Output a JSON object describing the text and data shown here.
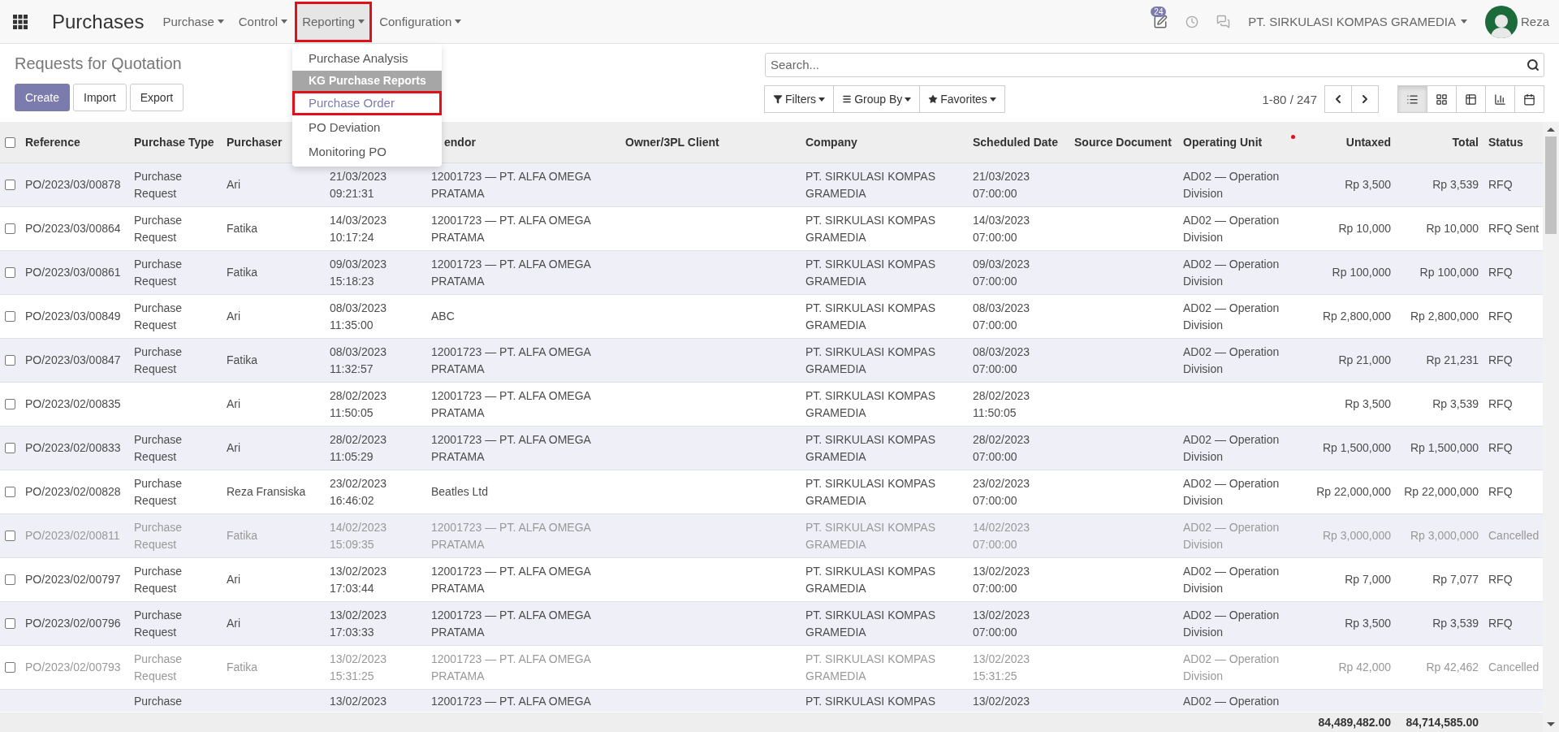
{
  "navbar": {
    "app_title": "Purchases",
    "menus": [
      {
        "label": "Purchase",
        "open": false,
        "highlighted": false
      },
      {
        "label": "Control",
        "open": false,
        "highlighted": false
      },
      {
        "label": "Reporting",
        "open": true,
        "highlighted": true
      },
      {
        "label": "Configuration",
        "open": false,
        "highlighted": false
      }
    ],
    "activity_count": "24",
    "company": "PT. SIRKULASI KOMPAS GRAMEDIA",
    "user": "Reza"
  },
  "reporting_menu": [
    {
      "kind": "item",
      "label": "Purchase Analysis",
      "highlighted": false
    },
    {
      "kind": "header",
      "label": "KG Purchase Reports",
      "highlighted": false
    },
    {
      "kind": "item",
      "label": "Purchase Order",
      "highlighted": true
    },
    {
      "kind": "item",
      "label": "PO Deviation",
      "highlighted": false
    },
    {
      "kind": "item",
      "label": "Monitoring PO",
      "highlighted": false
    }
  ],
  "control_panel": {
    "breadcrumb": "Requests for Quotation",
    "buttons": [
      {
        "label": "Create",
        "primary": true
      },
      {
        "label": "Import",
        "primary": false
      },
      {
        "label": "Export",
        "primary": false
      }
    ],
    "search": {
      "placeholder": "Search..."
    },
    "filters": [
      "Filters",
      "Group By",
      "Favorites"
    ],
    "pager": "1-80 / 247",
    "views": [
      {
        "kind": "list",
        "selected": true
      },
      {
        "kind": "kanban",
        "selected": false
      },
      {
        "kind": "pivot",
        "selected": false
      },
      {
        "kind": "graph",
        "selected": false
      },
      {
        "kind": "calendar",
        "selected": false
      }
    ]
  },
  "table": {
    "select_all_checked": false,
    "columns": [
      {
        "label": "Reference"
      },
      {
        "label": "Purchase Type"
      },
      {
        "label": "Purchaser"
      },
      {},
      {
        "label": "endor"
      },
      {
        "label": "Owner/3PL Client"
      },
      {
        "label": "Company"
      },
      {
        "label": "Scheduled Date"
      },
      {
        "label": "Source Document"
      },
      {
        "label": "Operating Unit"
      },
      {
        "label": "Untaxed"
      },
      {
        "label": "Total"
      },
      {
        "label": "Status"
      }
    ],
    "rows": [
      {
        "kind": "full",
        "checked": false,
        "muted": false,
        "cells": [
          "PO/2023/03/00878",
          "Purchase Request",
          "Ari",
          "21/03/2023 09:21:31",
          "12001723 — PT. ALFA OMEGA PRATAMA",
          "",
          "PT. SIRKULASI KOMPAS GRAMEDIA",
          "21/03/2023 07:00:00",
          "",
          "AD02 — Operation Division",
          "Rp 3,500",
          "Rp 3,539",
          "RFQ"
        ]
      },
      {
        "kind": "full",
        "checked": false,
        "muted": false,
        "cells": [
          "PO/2023/03/00864",
          "Purchase Request",
          "Fatika",
          "14/03/2023 10:17:24",
          "12001723 — PT. ALFA OMEGA PRATAMA",
          "",
          "PT. SIRKULASI KOMPAS GRAMEDIA",
          "14/03/2023 07:00:00",
          "",
          "AD02 — Operation Division",
          "Rp 10,000",
          "Rp 10,000",
          "RFQ Sent"
        ]
      },
      {
        "kind": "full",
        "checked": false,
        "muted": false,
        "cells": [
          "PO/2023/03/00861",
          "Purchase Request",
          "Fatika",
          "09/03/2023 15:18:23",
          "12001723 — PT. ALFA OMEGA PRATAMA",
          "",
          "PT. SIRKULASI KOMPAS GRAMEDIA",
          "09/03/2023 07:00:00",
          "",
          "AD02 — Operation Division",
          "Rp 100,000",
          "Rp 100,000",
          "RFQ"
        ]
      },
      {
        "kind": "full",
        "checked": false,
        "muted": false,
        "cells": [
          "PO/2023/03/00849",
          "Purchase Request",
          "Ari",
          "08/03/2023 11:35:00",
          "ABC",
          "",
          "PT. SIRKULASI KOMPAS GRAMEDIA",
          "08/03/2023 07:00:00",
          "",
          "AD02 — Operation Division",
          "Rp 2,800,000",
          "Rp 2,800,000",
          "RFQ"
        ]
      },
      {
        "kind": "full",
        "checked": false,
        "muted": false,
        "cells": [
          "PO/2023/03/00847",
          "Purchase Request",
          "Fatika",
          "08/03/2023 11:32:57",
          "12001723 — PT. ALFA OMEGA PRATAMA",
          "",
          "PT. SIRKULASI KOMPAS GRAMEDIA",
          "08/03/2023 07:00:00",
          "",
          "AD02 — Operation Division",
          "Rp 21,000",
          "Rp 21,231",
          "RFQ"
        ]
      },
      {
        "kind": "full",
        "checked": false,
        "muted": false,
        "cells": [
          "PO/2023/02/00835",
          "",
          "Ari",
          "28/02/2023 11:50:05",
          "12001723 — PT. ALFA OMEGA PRATAMA",
          "",
          "PT. SIRKULASI KOMPAS GRAMEDIA",
          "28/02/2023 11:50:05",
          "",
          "",
          "Rp 3,500",
          "Rp 3,539",
          "RFQ"
        ]
      },
      {
        "kind": "full",
        "checked": false,
        "muted": false,
        "cells": [
          "PO/2023/02/00833",
          "Purchase Request",
          "Ari",
          "28/02/2023 11:05:29",
          "12001723 — PT. ALFA OMEGA PRATAMA",
          "",
          "PT. SIRKULASI KOMPAS GRAMEDIA",
          "28/02/2023 07:00:00",
          "",
          "AD02 — Operation Division",
          "Rp 1,500,000",
          "Rp 1,500,000",
          "RFQ"
        ]
      },
      {
        "kind": "full",
        "checked": false,
        "muted": false,
        "cells": [
          "PO/2023/02/00828",
          "Purchase Request",
          "Reza Fransiska",
          "23/02/2023 16:46:02",
          "Beatles Ltd",
          "",
          "PT. SIRKULASI KOMPAS GRAMEDIA",
          "23/02/2023 07:00:00",
          "",
          "AD02 — Operation Division",
          "Rp 22,000,000",
          "Rp 22,000,000",
          "RFQ"
        ]
      },
      {
        "kind": "full",
        "checked": false,
        "muted": true,
        "cells": [
          "PO/2023/02/00811",
          "Purchase Request",
          "Fatika",
          "14/02/2023 15:09:35",
          "12001723 — PT. ALFA OMEGA PRATAMA",
          "",
          "PT. SIRKULASI KOMPAS GRAMEDIA",
          "14/02/2023 07:00:00",
          "",
          "AD02 — Operation Division",
          "Rp 3,000,000",
          "Rp 3,000,000",
          "Cancelled"
        ]
      },
      {
        "kind": "full",
        "checked": false,
        "muted": false,
        "cells": [
          "PO/2023/02/00797",
          "Purchase Request",
          "Ari",
          "13/02/2023 17:03:44",
          "12001723 — PT. ALFA OMEGA PRATAMA",
          "",
          "PT. SIRKULASI KOMPAS GRAMEDIA",
          "13/02/2023 07:00:00",
          "",
          "AD02 — Operation Division",
          "Rp 7,000",
          "Rp 7,077",
          "RFQ"
        ]
      },
      {
        "kind": "full",
        "checked": false,
        "muted": false,
        "cells": [
          "PO/2023/02/00796",
          "Purchase Request",
          "Ari",
          "13/02/2023 17:03:33",
          "12001723 — PT. ALFA OMEGA PRATAMA",
          "",
          "PT. SIRKULASI KOMPAS GRAMEDIA",
          "13/02/2023 07:00:00",
          "",
          "AD02 — Operation Division",
          "Rp 3,500",
          "Rp 3,539",
          "RFQ"
        ]
      },
      {
        "kind": "full",
        "checked": false,
        "muted": true,
        "cells": [
          "PO/2023/02/00793",
          "Purchase Request",
          "Fatika",
          "13/02/2023 15:31:25",
          "12001723 — PT. ALFA OMEGA PRATAMA",
          "",
          "PT. SIRKULASI KOMPAS GRAMEDIA",
          "13/02/2023 15:31:25",
          "",
          "AD02 — Operation Division",
          "Rp 42,000",
          "Rp 42,462",
          "Cancelled"
        ]
      },
      {
        "kind": "partial",
        "muted": false,
        "cells": [
          "",
          "Purchase",
          "",
          "13/02/2023",
          "12001723 — PT. ALFA OMEGA",
          "",
          "PT. SIRKULASI KOMPAS",
          "13/02/2023",
          "",
          "AD02 — Operation",
          "",
          "",
          ""
        ]
      }
    ],
    "totals": {
      "untaxed": "84,489,482.00",
      "total": "84,714,585.00"
    }
  }
}
